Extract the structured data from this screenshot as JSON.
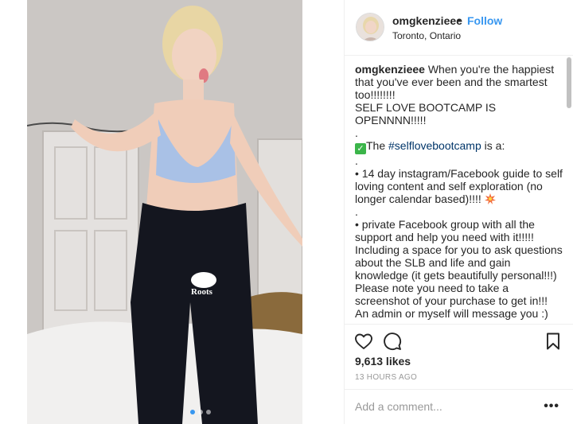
{
  "post": {
    "username": "omgkenzieee",
    "separator": "•",
    "follow_label": "Follow",
    "location": "Toronto, Ontario",
    "photo_brand_text": "Roots"
  },
  "caption": {
    "username": "omgkenzieee",
    "lines": {
      "l1": " When you're the happiest that you've ever been and the smartest too!!!!!!!!\nSELF LOVE BOOTCAMP IS OPENNNN!!!!!\n.\n",
      "l2_pre": "The ",
      "hashtag": "#selflovebootcamp",
      "l2_post": " is a:\n.\n• 14 day instagram/Facebook guide to self loving content and self exploration (no longer calendar based)!!!! ",
      "l3": "\n.\n• private Facebook group with all the support and help you need with it!!!!! Including a space for you to ask questions about the SLB and life and gain knowledge (it gets beautifully personal!!!) Please note you need to take a screenshot of your purchase to get in!!! An admin or myself will message you :)"
    }
  },
  "icons": {
    "check": "check-mark-emoji-icon",
    "burst": "collision-emoji-icon",
    "like": "heart-icon",
    "comment": "comment-icon",
    "save": "bookmark-icon"
  },
  "engagement": {
    "likes": "9,613 likes",
    "time": "13 HOURS AGO"
  },
  "comment": {
    "placeholder": "Add a comment...",
    "more_label": "•••"
  },
  "colors": {
    "link": "#3897f0",
    "hashtag": "#003569",
    "muted": "#999999"
  }
}
